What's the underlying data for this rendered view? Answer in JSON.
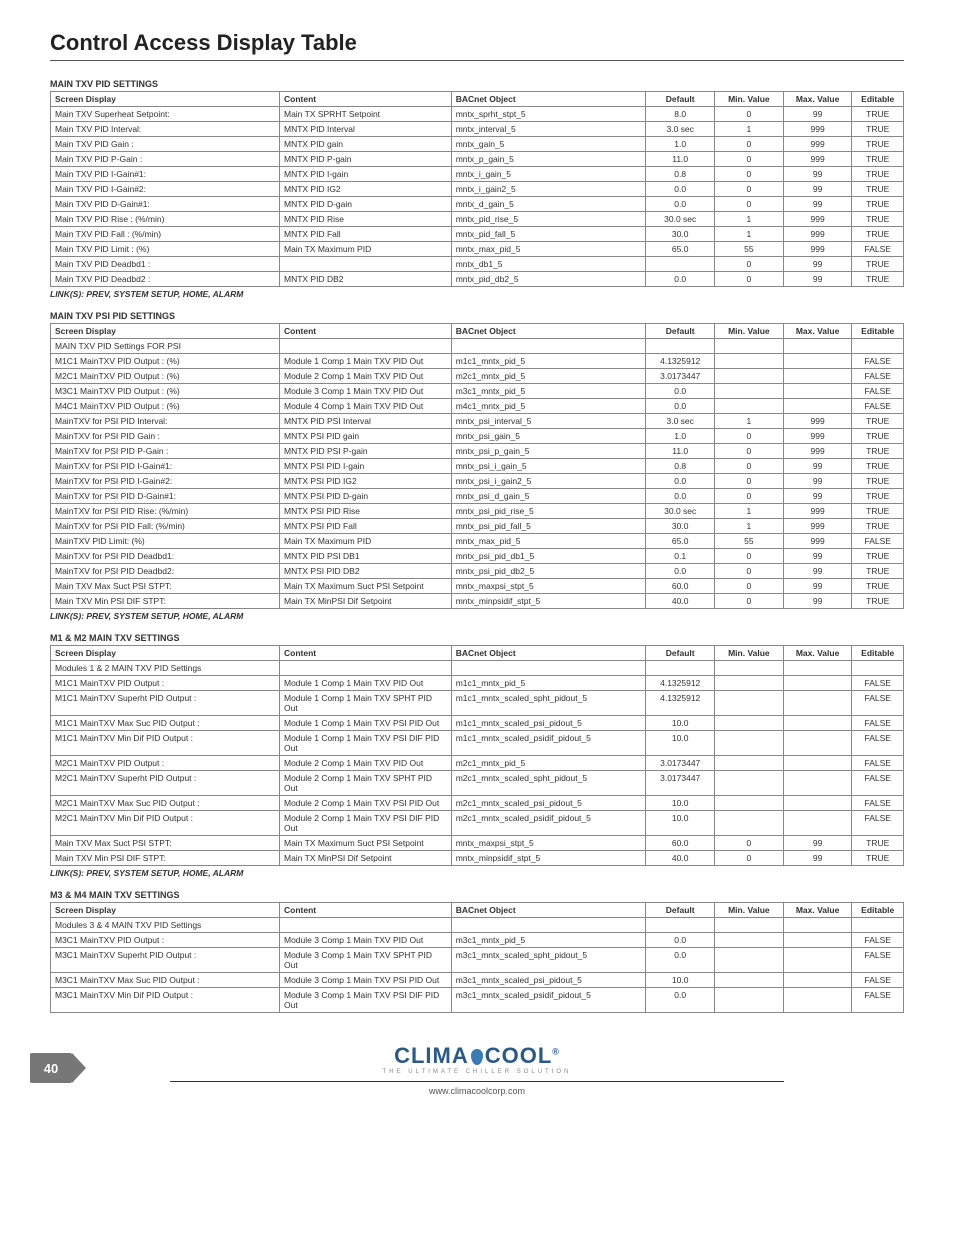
{
  "page_title": "Control Access Display Table",
  "link_text": "LINK(S): PREV, SYSTEM SETUP, HOME, ALARM",
  "headers": [
    "Screen Display",
    "Content",
    "BACnet Object",
    "Default",
    "Min. Value",
    "Max. Value",
    "Editable"
  ],
  "footer": {
    "page": "40",
    "brand_a": "CLIMA",
    "brand_b": "COOL",
    "tag": "THE ULTIMATE CHILLER SOLUTION",
    "url": "www.climacoolcorp.com"
  },
  "sections": [
    {
      "title": "MAIN TXV PID SETTINGS",
      "link_after": true,
      "rows": [
        [
          "Main TXV Superheat Setpoint:",
          "Main TX SPRHT Setpoint",
          "mntx_sprht_stpt_5",
          "8.0",
          "0",
          "99",
          "TRUE"
        ],
        [
          "Main  TXV  PID Interval:",
          "MNTX PID Interval",
          "mntx_interval_5",
          "3.0 sec",
          "1",
          "999",
          "TRUE"
        ],
        [
          "Main  TXV  PID Gain    :",
          "MNTX PID gain",
          "mntx_gain_5",
          "1.0",
          "0",
          "999",
          "TRUE"
        ],
        [
          "Main  TXV  PID P-Gain :",
          "MNTX PID P-gain",
          "mntx_p_gain_5",
          "11.0",
          "0",
          "999",
          "TRUE"
        ],
        [
          "Main  TXV  PID I-Gain#1:",
          "MNTX PID I-gain",
          "mntx_i_gain_5",
          "0.8",
          "0",
          "99",
          "TRUE"
        ],
        [
          "Main  TXV  PID I-Gain#2:",
          "MNTX PID IG2",
          "mntx_i_gain2_5",
          "0.0",
          "0",
          "99",
          "TRUE"
        ],
        [
          "Main  TXV  PID D-Gain#1:",
          "MNTX PID D-gain",
          "mntx_d_gain_5",
          "0.0",
          "0",
          "99",
          "TRUE"
        ],
        [
          "Main  TXV  PID Rise    : (%/min)",
          "MNTX PID Rise",
          "mntx_pid_rise_5",
          "30.0 sec",
          "1",
          "999",
          "TRUE"
        ],
        [
          "Main  TXV  PID Fall    : (%/min)",
          "MNTX PID Fall",
          "mntx_pid_fall_5",
          "30.0",
          "1",
          "999",
          "TRUE"
        ],
        [
          "Main  TXV  PID Limit  : (%)",
          "Main TX Maximum PID",
          "mntx_max_pid_5",
          "65.0",
          "55",
          "999",
          "FALSE"
        ],
        [
          "Main  TXV  PID Deadbd1 :",
          "",
          "mntx_db1_5",
          "",
          "0",
          "99",
          "TRUE"
        ],
        [
          "Main  TXV  PID Deadbd2 :",
          "MNTX PID DB2",
          "mntx_pid_db2_5",
          "0.0",
          "0",
          "99",
          "TRUE"
        ]
      ]
    },
    {
      "title": "MAIN TXV PSI PID SETTINGS",
      "link_after": true,
      "rows": [
        [
          "MAIN TXV PID Settings FOR PSI",
          "",
          "",
          "",
          "",
          "",
          ""
        ],
        [
          "M1C1 MainTXV PID Output : (%)",
          "Module 1 Comp 1 Main TXV PID Out",
          "m1c1_mntx_pid_5",
          "4.1325912",
          "",
          "",
          "FALSE"
        ],
        [
          "M2C1 MainTXV PID Output : (%)",
          "Module 2 Comp 1 Main TXV PID Out",
          "m2c1_mntx_pid_5",
          "3.0173447",
          "",
          "",
          "FALSE"
        ],
        [
          "M3C1 MainTXV PID Output : (%)",
          "Module 3 Comp 1 Main TXV PID Out",
          "m3c1_mntx_pid_5",
          "0.0",
          "",
          "",
          "FALSE"
        ],
        [
          "M4C1 MainTXV PID Output : (%)",
          "Module 4 Comp 1 Main TXV PID Out",
          "m4c1_mntx_pid_5",
          "0.0",
          "",
          "",
          "FALSE"
        ],
        [
          "MainTXV for PSI PID Interval:",
          "MNTX PID PSI Interval",
          "mntx_psi_interval_5",
          "3.0 sec",
          "1",
          "999",
          "TRUE"
        ],
        [
          "MainTXV for PSI PID Gain    :",
          "MNTX PSI PID gain",
          "mntx_psi_gain_5",
          "1.0",
          "0",
          "999",
          "TRUE"
        ],
        [
          "MainTXV for PSI PID P-Gain  :",
          "MNTX PID PSI P-gain",
          "mntx_psi_p_gain_5",
          "11.0",
          "0",
          "999",
          "TRUE"
        ],
        [
          "MainTXV for PSI PID I-Gain#1:",
          "MNTX PSI PID I-gain",
          "mntx_psi_i_gain_5",
          "0.8",
          "0",
          "99",
          "TRUE"
        ],
        [
          "MainTXV for PSI PID I-Gain#2:",
          "MNTX PSI PID IG2",
          "mntx_psi_i_gain2_5",
          "0.0",
          "0",
          "99",
          "TRUE"
        ],
        [
          "MainTXV for PSI PID D-Gain#1:",
          "MNTX PSI PID D-gain",
          "mntx_psi_d_gain_5",
          "0.0",
          "0",
          "99",
          "TRUE"
        ],
        [
          "MainTXV for PSI PID Rise: (%/min)",
          "MNTX PSI PID Rise",
          "mntx_psi_pid_rise_5",
          "30.0 sec",
          "1",
          "999",
          "TRUE"
        ],
        [
          "MainTXV for PSI PID Fall: (%/min)",
          "MNTX PSI PID Fall",
          "mntx_psi_pid_fall_5",
          "30.0",
          "1",
          "999",
          "TRUE"
        ],
        [
          "MainTXV PID  Limit: (%)",
          "Main TX Maximum PID",
          "mntx_max_pid_5",
          "65.0",
          "55",
          "999",
          "FALSE"
        ],
        [
          "MainTXV for PSI PID Deadbd1:",
          "MNTX PID PSI DB1",
          "mntx_psi_pid_db1_5",
          "0.1",
          "0",
          "99",
          "TRUE"
        ],
        [
          "MainTXV for PSI PID Deadbd2:",
          "MNTX PSI PID DB2",
          "mntx_psi_pid_db2_5",
          "0.0",
          "0",
          "99",
          "TRUE"
        ],
        [
          "Main TXV Max Suct PSI STPT:",
          "Main TX Maximum Suct PSI Setpoint",
          "mntx_maxpsi_stpt_5",
          "60.0",
          "0",
          "99",
          "TRUE"
        ],
        [
          "Main TXV Min PSI DIF  STPT:",
          "Main TX MinPSI Dif Setpoint",
          "mntx_minpsidif_stpt_5",
          "40.0",
          "0",
          "99",
          "TRUE"
        ]
      ]
    },
    {
      "title": "M1 & M2 MAIN TXV SETTINGS",
      "link_after": true,
      "rows": [
        [
          "Modules 1 & 2 MAIN TXV PID Settings",
          "",
          "",
          "",
          "",
          "",
          ""
        ],
        [
          "M1C1     MainTXV PID Output :",
          "Module 1 Comp 1 Main TXV PID Out",
          "m1c1_mntx_pid_5",
          "4.1325912",
          "",
          "",
          "FALSE"
        ],
        [
          "M1C1 MainTXV Superht PID Output :",
          "Module 1 Comp 1 Main TXV SPHT PID Out",
          "m1c1_mntx_scaled_spht_pidout_5",
          "4.1325912",
          "",
          "",
          "FALSE"
        ],
        [
          "M1C1 MainTXV Max Suc PID Output :",
          "Module 1 Comp 1 Main TXV PSI PID Out",
          "m1c1_mntx_scaled_psi_pidout_5",
          "10.0",
          "",
          "",
          "FALSE"
        ],
        [
          "M1C1 MainTXV Min Dif PID Output :",
          "Module 1 Comp 1 Main TXV PSI DIF PID Out",
          "m1c1_mntx_scaled_psidif_pidout_5",
          "10.0",
          "",
          "",
          "FALSE"
        ],
        [
          "M2C1     MainTXV PID Output :",
          "Module 2 Comp 1 Main TXV PID Out",
          "m2c1_mntx_pid_5",
          "3.0173447",
          "",
          "",
          "FALSE"
        ],
        [
          "M2C1 MainTXV Superht PID Output :",
          "Module 2 Comp 1 Main TXV SPHT PID Out",
          "m2c1_mntx_scaled_spht_pidout_5",
          "3.0173447",
          "",
          "",
          "FALSE"
        ],
        [
          "M2C1 MainTXV Max Suc PID Output :",
          "Module 2 Comp 1 Main TXV PSI PID Out",
          "m2c1_mntx_scaled_psi_pidout_5",
          "10.0",
          "",
          "",
          "FALSE"
        ],
        [
          "M2C1 MainTXV Min Dif PID Output :",
          "Module 2 Comp 1 Main TXV PSI DIF PID Out",
          "m2c1_mntx_scaled_psidif_pidout_5",
          "10.0",
          "",
          "",
          "FALSE"
        ],
        [
          "Main TXV Max Suct PSI STPT:",
          "Main TX Maximum Suct PSI Setpoint",
          "mntx_maxpsi_stpt_5",
          "60.0",
          "0",
          "99",
          "TRUE"
        ],
        [
          "Main TXV Min PSI DIF  STPT:",
          "Main TX MinPSI Dif Setpoint",
          "mntx_minpsidif_stpt_5",
          "40.0",
          "0",
          "99",
          "TRUE"
        ]
      ]
    },
    {
      "title": "M3 & M4 MAIN TXV SETTINGS",
      "link_after": false,
      "rows": [
        [
          "Modules 3 & 4 MAIN TXV PID Settings",
          "",
          "",
          "",
          "",
          "",
          ""
        ],
        [
          "M3C1     MainTXV PID Output :",
          "Module 3 Comp 1 Main TXV PID Out",
          "m3c1_mntx_pid_5",
          "0.0",
          "",
          "",
          "FALSE"
        ],
        [
          "M3C1 MainTXV Superht PID Output :",
          "Module 3 Comp 1 Main TXV SPHT PID Out",
          "m3c1_mntx_scaled_spht_pidout_5",
          "0.0",
          "",
          "",
          "FALSE"
        ],
        [
          "M3C1 MainTXV Max Suc PID Output :",
          "Module 3 Comp 1 Main TXV PSI PID Out",
          "m3c1_mntx_scaled_psi_pidout_5",
          "10.0",
          "",
          "",
          "FALSE"
        ],
        [
          "M3C1 MainTXV Min Dif PID Output :",
          "Module 3 Comp 1 Main TXV PSI DIF PID Out",
          "m3c1_mntx_scaled_psidif_pidout_5",
          "0.0",
          "",
          "",
          "FALSE"
        ]
      ]
    }
  ]
}
